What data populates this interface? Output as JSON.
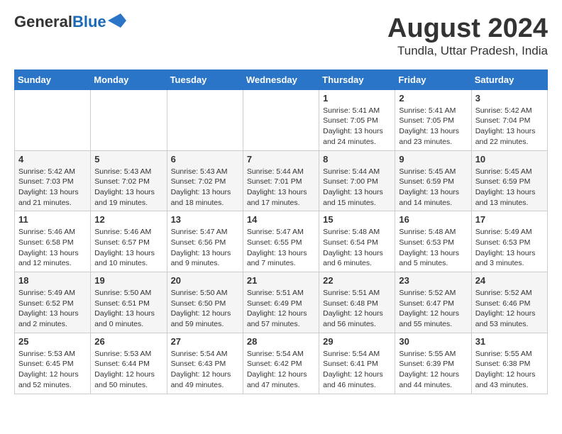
{
  "header": {
    "logo_general": "General",
    "logo_blue": "Blue",
    "month_year": "August 2024",
    "location": "Tundla, Uttar Pradesh, India"
  },
  "weekdays": [
    "Sunday",
    "Monday",
    "Tuesday",
    "Wednesday",
    "Thursday",
    "Friday",
    "Saturday"
  ],
  "weeks": [
    [
      {
        "day": "",
        "info": ""
      },
      {
        "day": "",
        "info": ""
      },
      {
        "day": "",
        "info": ""
      },
      {
        "day": "",
        "info": ""
      },
      {
        "day": "1",
        "info": "Sunrise: 5:41 AM\nSunset: 7:05 PM\nDaylight: 13 hours\nand 24 minutes."
      },
      {
        "day": "2",
        "info": "Sunrise: 5:41 AM\nSunset: 7:05 PM\nDaylight: 13 hours\nand 23 minutes."
      },
      {
        "day": "3",
        "info": "Sunrise: 5:42 AM\nSunset: 7:04 PM\nDaylight: 13 hours\nand 22 minutes."
      }
    ],
    [
      {
        "day": "4",
        "info": "Sunrise: 5:42 AM\nSunset: 7:03 PM\nDaylight: 13 hours\nand 21 minutes."
      },
      {
        "day": "5",
        "info": "Sunrise: 5:43 AM\nSunset: 7:02 PM\nDaylight: 13 hours\nand 19 minutes."
      },
      {
        "day": "6",
        "info": "Sunrise: 5:43 AM\nSunset: 7:02 PM\nDaylight: 13 hours\nand 18 minutes."
      },
      {
        "day": "7",
        "info": "Sunrise: 5:44 AM\nSunset: 7:01 PM\nDaylight: 13 hours\nand 17 minutes."
      },
      {
        "day": "8",
        "info": "Sunrise: 5:44 AM\nSunset: 7:00 PM\nDaylight: 13 hours\nand 15 minutes."
      },
      {
        "day": "9",
        "info": "Sunrise: 5:45 AM\nSunset: 6:59 PM\nDaylight: 13 hours\nand 14 minutes."
      },
      {
        "day": "10",
        "info": "Sunrise: 5:45 AM\nSunset: 6:59 PM\nDaylight: 13 hours\nand 13 minutes."
      }
    ],
    [
      {
        "day": "11",
        "info": "Sunrise: 5:46 AM\nSunset: 6:58 PM\nDaylight: 13 hours\nand 12 minutes."
      },
      {
        "day": "12",
        "info": "Sunrise: 5:46 AM\nSunset: 6:57 PM\nDaylight: 13 hours\nand 10 minutes."
      },
      {
        "day": "13",
        "info": "Sunrise: 5:47 AM\nSunset: 6:56 PM\nDaylight: 13 hours\nand 9 minutes."
      },
      {
        "day": "14",
        "info": "Sunrise: 5:47 AM\nSunset: 6:55 PM\nDaylight: 13 hours\nand 7 minutes."
      },
      {
        "day": "15",
        "info": "Sunrise: 5:48 AM\nSunset: 6:54 PM\nDaylight: 13 hours\nand 6 minutes."
      },
      {
        "day": "16",
        "info": "Sunrise: 5:48 AM\nSunset: 6:53 PM\nDaylight: 13 hours\nand 5 minutes."
      },
      {
        "day": "17",
        "info": "Sunrise: 5:49 AM\nSunset: 6:53 PM\nDaylight: 13 hours\nand 3 minutes."
      }
    ],
    [
      {
        "day": "18",
        "info": "Sunrise: 5:49 AM\nSunset: 6:52 PM\nDaylight: 13 hours\nand 2 minutes."
      },
      {
        "day": "19",
        "info": "Sunrise: 5:50 AM\nSunset: 6:51 PM\nDaylight: 13 hours\nand 0 minutes."
      },
      {
        "day": "20",
        "info": "Sunrise: 5:50 AM\nSunset: 6:50 PM\nDaylight: 12 hours\nand 59 minutes."
      },
      {
        "day": "21",
        "info": "Sunrise: 5:51 AM\nSunset: 6:49 PM\nDaylight: 12 hours\nand 57 minutes."
      },
      {
        "day": "22",
        "info": "Sunrise: 5:51 AM\nSunset: 6:48 PM\nDaylight: 12 hours\nand 56 minutes."
      },
      {
        "day": "23",
        "info": "Sunrise: 5:52 AM\nSunset: 6:47 PM\nDaylight: 12 hours\nand 55 minutes."
      },
      {
        "day": "24",
        "info": "Sunrise: 5:52 AM\nSunset: 6:46 PM\nDaylight: 12 hours\nand 53 minutes."
      }
    ],
    [
      {
        "day": "25",
        "info": "Sunrise: 5:53 AM\nSunset: 6:45 PM\nDaylight: 12 hours\nand 52 minutes."
      },
      {
        "day": "26",
        "info": "Sunrise: 5:53 AM\nSunset: 6:44 PM\nDaylight: 12 hours\nand 50 minutes."
      },
      {
        "day": "27",
        "info": "Sunrise: 5:54 AM\nSunset: 6:43 PM\nDaylight: 12 hours\nand 49 minutes."
      },
      {
        "day": "28",
        "info": "Sunrise: 5:54 AM\nSunset: 6:42 PM\nDaylight: 12 hours\nand 47 minutes."
      },
      {
        "day": "29",
        "info": "Sunrise: 5:54 AM\nSunset: 6:41 PM\nDaylight: 12 hours\nand 46 minutes."
      },
      {
        "day": "30",
        "info": "Sunrise: 5:55 AM\nSunset: 6:39 PM\nDaylight: 12 hours\nand 44 minutes."
      },
      {
        "day": "31",
        "info": "Sunrise: 5:55 AM\nSunset: 6:38 PM\nDaylight: 12 hours\nand 43 minutes."
      }
    ]
  ]
}
